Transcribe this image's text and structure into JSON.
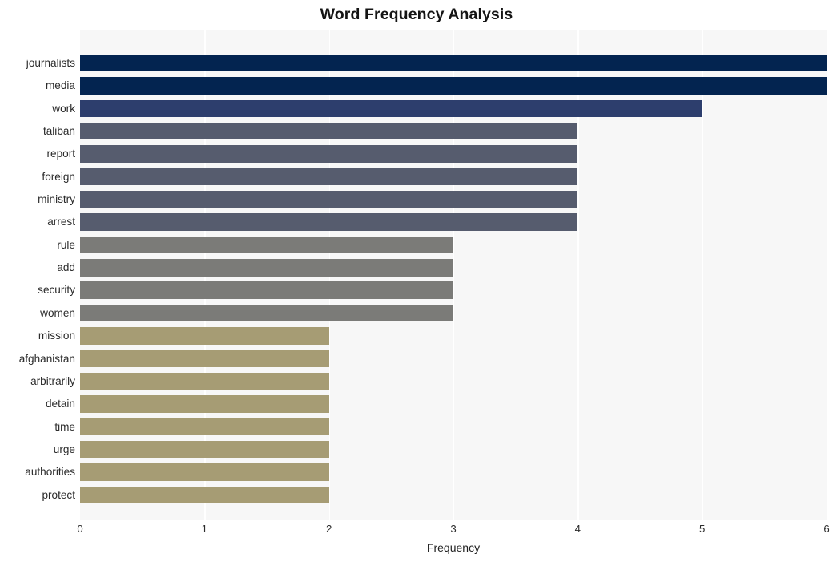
{
  "chart_data": {
    "type": "bar",
    "orientation": "horizontal",
    "title": "Word Frequency Analysis",
    "xlabel": "Frequency",
    "ylabel": "",
    "xlim": [
      0,
      6
    ],
    "xticks": [
      0,
      1,
      2,
      3,
      4,
      5,
      6
    ],
    "xticklabels": [
      "0",
      "1",
      "2",
      "3",
      "4",
      "5",
      "6"
    ],
    "grid": true,
    "grid_axis": "x",
    "grid_color": "#ffffff",
    "plot_background": "#f7f7f7",
    "figure_background": "#ffffff",
    "legend": null,
    "categories": [
      "journalists",
      "media",
      "work",
      "taliban",
      "report",
      "foreign",
      "ministry",
      "arrest",
      "rule",
      "add",
      "security",
      "women",
      "mission",
      "afghanistan",
      "arbitrarily",
      "detain",
      "time",
      "urge",
      "authorities",
      "protect"
    ],
    "values": [
      6,
      6,
      5,
      4,
      4,
      4,
      4,
      4,
      3,
      3,
      3,
      3,
      2,
      2,
      2,
      2,
      2,
      2,
      2,
      2
    ],
    "bar_colors": [
      "#032450",
      "#032450",
      "#2d3e6d",
      "#565c6e",
      "#565c6e",
      "#565c6e",
      "#565c6e",
      "#565c6e",
      "#7b7b78",
      "#7b7b78",
      "#7b7b78",
      "#7b7b78",
      "#a69c74",
      "#a69c74",
      "#a69c74",
      "#a69c74",
      "#a69c74",
      "#a69c74",
      "#a69c74",
      "#a69c74"
    ]
  }
}
